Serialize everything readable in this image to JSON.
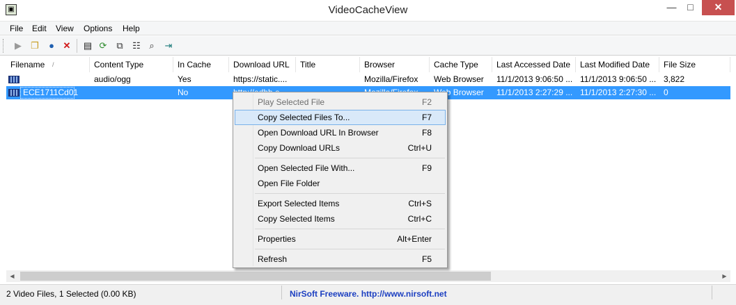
{
  "window": {
    "title": "VideoCacheView",
    "minimize_glyph": "—",
    "maximize_glyph": "□",
    "close_glyph": "✕"
  },
  "menu": [
    "File",
    "Edit",
    "View",
    "Options",
    "Help"
  ],
  "toolbar": {
    "icons": [
      "play-icon",
      "copy-files-to-icon",
      "open-url-browser-icon",
      "delete-icon",
      "save-icon",
      "refresh-icon",
      "copy-icon",
      "properties-icon",
      "find-icon",
      "exit-icon"
    ]
  },
  "columns": [
    "Filename",
    "Content Type",
    "In Cache",
    "Download URL",
    "Title",
    "Browser",
    "Cache Type",
    "Last Accessed Date",
    "Last Modified Date",
    "File Size"
  ],
  "rows": [
    {
      "filename": "",
      "content_type": "audio/ogg",
      "in_cache": "Yes",
      "download_url": "https://static....",
      "title": "",
      "browser": "Mozilla/Firefox",
      "cache_type": "Web Browser",
      "last_accessed": "11/1/2013 9:06:50 ...",
      "last_modified": "11/1/2013 9:06:50 ...",
      "file_size": "3,822",
      "selected": false
    },
    {
      "filename": "ECE1711Cd01",
      "content_type": "",
      "in_cache": "No",
      "download_url": "http://edhb.e...",
      "title": "",
      "browser": "Mozilla/Firefox",
      "cache_type": "Web Browser",
      "last_accessed": "11/1/2013 2:27:29 ...",
      "last_modified": "11/1/2013 2:27:30 ...",
      "file_size": "0",
      "selected": true
    }
  ],
  "context_menu": {
    "items": [
      {
        "label": "Play Selected File",
        "shortcut": "F2",
        "disabled": true
      },
      {
        "label": "Copy Selected Files To...",
        "shortcut": "F7",
        "highlighted": true
      },
      {
        "label": "Open Download URL In Browser",
        "shortcut": "F8"
      },
      {
        "label": "Copy Download URLs",
        "shortcut": "Ctrl+U"
      },
      {
        "label": "Open Selected File With...",
        "shortcut": "F9"
      },
      {
        "label": "Open File Folder",
        "shortcut": ""
      },
      {
        "label": "Export Selected Items",
        "shortcut": "Ctrl+S"
      },
      {
        "label": "Copy Selected Items",
        "shortcut": "Ctrl+C"
      },
      {
        "label": "Properties",
        "shortcut": "Alt+Enter"
      },
      {
        "label": "Refresh",
        "shortcut": "F5"
      }
    ]
  },
  "status": {
    "summary": "2 Video Files, 1 Selected  (0.00 KB)",
    "link": "NirSoft Freeware.  http://www.nirsoft.net"
  },
  "colors": {
    "selection": "#3399ff",
    "menu_hover": "#d9e9f9",
    "close_button": "#c75050",
    "link": "#1c3fc1"
  }
}
